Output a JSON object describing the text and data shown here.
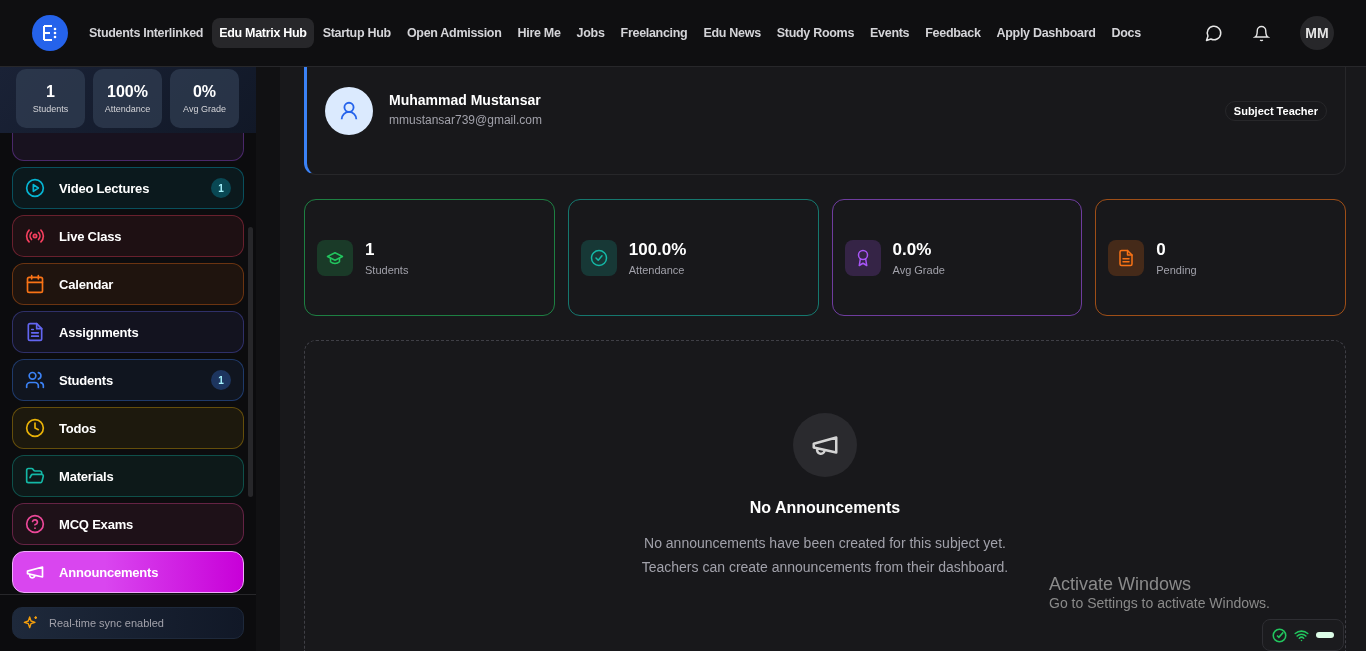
{
  "nav": {
    "items": [
      {
        "label": "Students Interlinked",
        "selected": false
      },
      {
        "label": "Edu Matrix Hub",
        "selected": true
      },
      {
        "label": "Startup Hub",
        "selected": false
      },
      {
        "label": "Open Admission",
        "selected": false
      },
      {
        "label": "Hire Me",
        "selected": false
      },
      {
        "label": "Jobs",
        "selected": false
      },
      {
        "label": "Freelancing",
        "selected": false
      },
      {
        "label": "Edu News",
        "selected": false
      },
      {
        "label": "Study Rooms",
        "selected": false
      },
      {
        "label": "Events",
        "selected": false
      },
      {
        "label": "Feedback",
        "selected": false
      },
      {
        "label": "Apply Dashboard",
        "selected": false
      },
      {
        "label": "Docs",
        "selected": false
      }
    ],
    "avatar": "MM"
  },
  "sidebar": {
    "stats": [
      {
        "value": "1",
        "label": "Students"
      },
      {
        "value": "100%",
        "label": "Attendance"
      },
      {
        "value": "0%",
        "label": "Avg Grade"
      }
    ],
    "items": [
      {
        "label": "Video Lectures",
        "badge": "1",
        "color": "#06b6d4",
        "selected": false
      },
      {
        "label": "Live Class",
        "color": "#f43f5e",
        "selected": false
      },
      {
        "label": "Calendar",
        "color": "#f97316",
        "selected": false
      },
      {
        "label": "Assignments",
        "color": "#6366f1",
        "selected": false
      },
      {
        "label": "Students",
        "badge": "1",
        "color": "#3b82f6",
        "selected": false
      },
      {
        "label": "Todos",
        "color": "#eab308",
        "selected": false
      },
      {
        "label": "Materials",
        "color": "#14b8a6",
        "selected": false
      },
      {
        "label": "MCQ Exams",
        "color": "#ec4899",
        "selected": false
      },
      {
        "label": "Announcements",
        "color": "#d946ef",
        "selected": true
      }
    ],
    "sync": "Real-time sync enabled"
  },
  "profile": {
    "name": "Muhammad Mustansar",
    "email": "mmustansar739@gmail.com",
    "role": "Subject Teacher"
  },
  "stats": [
    {
      "value": "1",
      "label": "Students",
      "color": "#22c55e"
    },
    {
      "value": "100.0%",
      "label": "Attendance",
      "color": "#14b8a6"
    },
    {
      "value": "0.0%",
      "label": "Avg Grade",
      "color": "#a855f7"
    },
    {
      "value": "0",
      "label": "Pending",
      "color": "#f97316"
    }
  ],
  "empty": {
    "title": "No Announcements",
    "lines": [
      "No announcements have been created for this subject yet.",
      "Teachers can create announcements from their dashboard."
    ]
  },
  "watermark": {
    "title": "Activate Windows",
    "text": "Go to Settings to activate Windows."
  }
}
